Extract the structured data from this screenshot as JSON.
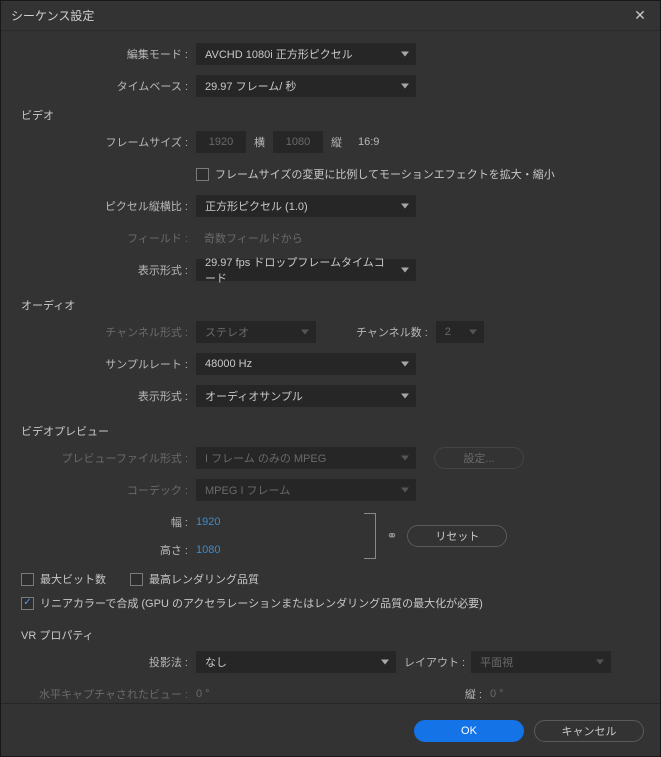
{
  "title": "シーケンス設定",
  "rows": {
    "editMode": {
      "label": "編集モード :",
      "value": "AVCHD 1080i 正方形ピクセル"
    },
    "timebase": {
      "label": "タイムベース :",
      "value": "29.97 フレーム/ 秒"
    }
  },
  "video": {
    "section": "ビデオ",
    "frameSizeLabel": "フレームサイズ :",
    "width": "1920",
    "wLabel": "横",
    "height": "1080",
    "hLabel": "縦",
    "aspect": "16:9",
    "scaleMotionCb": "フレームサイズの変更に比例してモーションエフェクトを拡大・縮小",
    "par": {
      "label": "ピクセル縦横比 :",
      "value": "正方形ピクセル (1.0)"
    },
    "field": {
      "label": "フィールド :",
      "value": "奇数フィールドから"
    },
    "display": {
      "label": "表示形式 :",
      "value": "29.97 fps ドロップフレームタイムコード"
    }
  },
  "audio": {
    "section": "オーディオ",
    "chFormat": {
      "label": "チャンネル形式 :",
      "value": "ステレオ"
    },
    "chCount": {
      "label": "チャンネル数 :",
      "value": "2"
    },
    "sampleRate": {
      "label": "サンプルレート :",
      "value": "48000 Hz"
    },
    "display": {
      "label": "表示形式 :",
      "value": "オーディオサンプル"
    }
  },
  "preview": {
    "section": "ビデオプレビュー",
    "fileFormat": {
      "label": "プレビューファイル形式 :",
      "value": "I フレーム のみの MPEG"
    },
    "codec": {
      "label": "コーデック :",
      "value": "MPEG I フレーム"
    },
    "widthLabel": "幅 :",
    "width": "1920",
    "heightLabel": "高さ :",
    "height": "1080",
    "configure": "設定...",
    "reset": "リセット",
    "maxBitDepth": "最大ビット数",
    "maxRenderQual": "最高レンダリング品質",
    "linearColor": "リニアカラーで合成 (GPU のアクセラレーションまたはレンダリング品質の最大化が必要)"
  },
  "vr": {
    "section": "VR プロパティ",
    "projection": {
      "label": "投影法 :",
      "value": "なし"
    },
    "layout": {
      "label": "レイアウト :",
      "value": "平面視"
    },
    "horizLabel": "水平キャプチャされたビュー :",
    "horizValue": "0 °",
    "vertLabel": "縦 :",
    "vertValue": "0 °"
  },
  "footer": {
    "ok": "OK",
    "cancel": "キャンセル"
  }
}
